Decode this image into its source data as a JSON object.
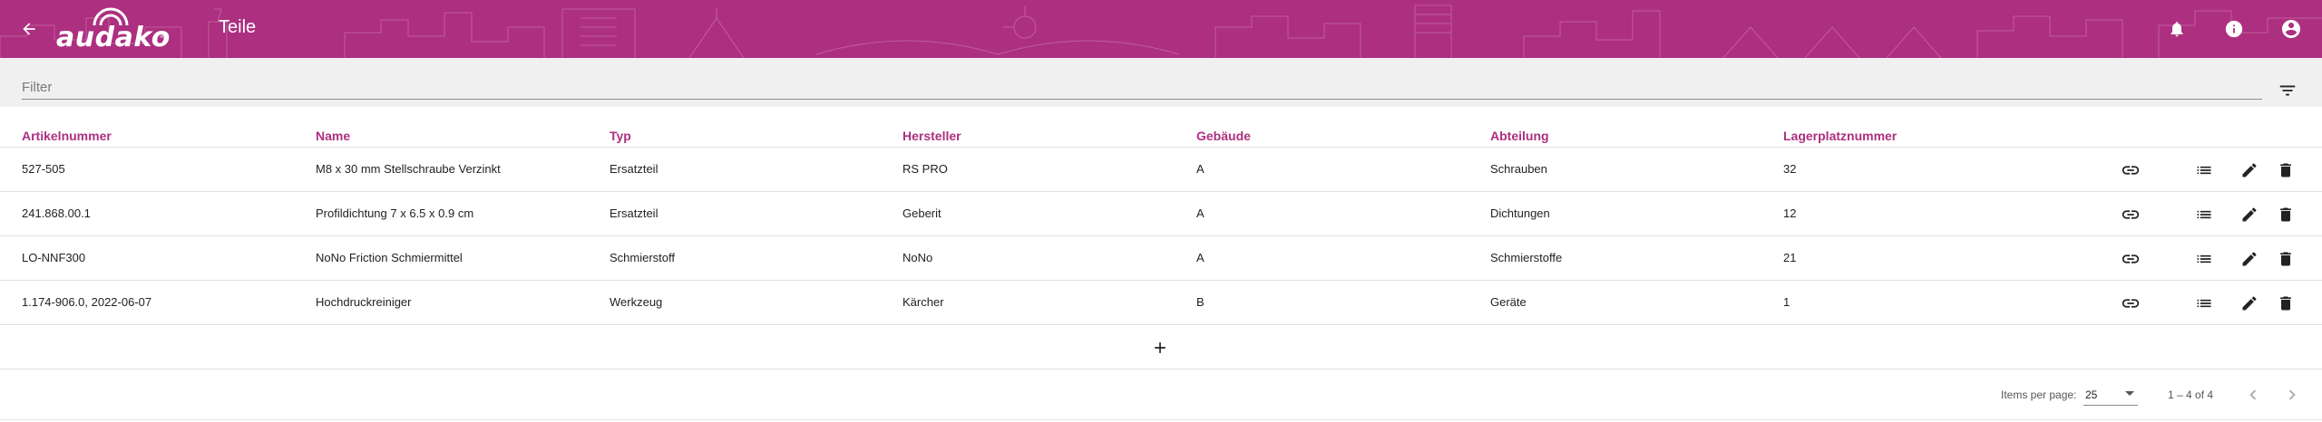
{
  "header": {
    "logo_text": "audako",
    "logo_reg": "®",
    "title": "Teile",
    "back_icon": "arrow-left-icon",
    "notification_icon": "bell-icon",
    "info_icon": "info-icon",
    "account_icon": "account-circle-icon"
  },
  "colors": {
    "brand": "#ad2f80",
    "filter_bg": "#f0f0f0",
    "icon_dark": "#222222"
  },
  "filter": {
    "placeholder": "Filter",
    "value": "",
    "icon": "filter-list-icon"
  },
  "table": {
    "columns": [
      "Artikelnummer",
      "Name",
      "Typ",
      "Hersteller",
      "Gebäude",
      "Abteilung",
      "Lagerplatznummer"
    ],
    "rows": [
      [
        "527-505",
        "M8 x 30 mm Stellschraube Verzinkt",
        "Ersatzteil",
        "RS PRO",
        "A",
        "Schrauben",
        "32"
      ],
      [
        "241.868.00.1",
        "Profildichtung 7 x 6.5 x 0.9 cm",
        "Ersatzteil",
        "Geberit",
        "A",
        "Dichtungen",
        "12"
      ],
      [
        "LO-NNF300",
        "NoNo Friction Schmiermittel",
        "Schmierstoff",
        "NoNo",
        "A",
        "Schmierstoffe",
        "21"
      ],
      [
        "1.174-906.0, 2022-06-07",
        "Hochdruckreiniger",
        "Werkzeug",
        "Kärcher",
        "B",
        "Geräte",
        "1"
      ]
    ],
    "row_actions": [
      "link-icon",
      "list-icon",
      "edit-pencil-icon",
      "delete-trash-icon"
    ],
    "add_icon": "plus-icon"
  },
  "paginator": {
    "items_per_page_label": "Items per page:",
    "items_per_page": "25",
    "range": "1 – 4 of 4",
    "prev_icon": "chevron-left-icon",
    "next_icon": "chevron-right-icon"
  }
}
